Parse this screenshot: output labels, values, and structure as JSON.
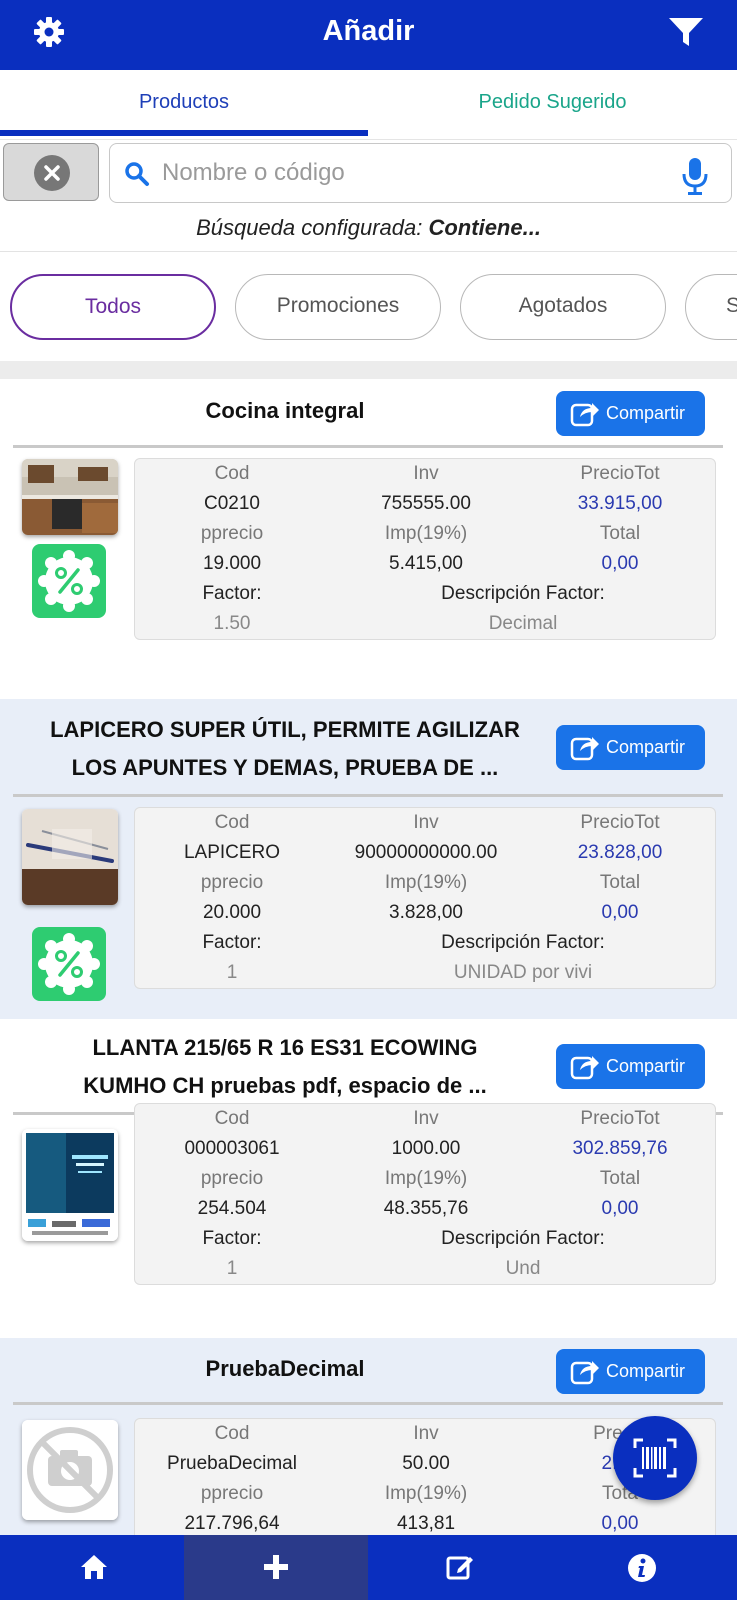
{
  "header": {
    "title": "Añadir",
    "settings_icon": "gear-icon",
    "filter_icon": "filter-icon"
  },
  "tabs": [
    {
      "label": "Productos",
      "active": true
    },
    {
      "label": "Pedido Sugerido",
      "active": false
    }
  ],
  "search": {
    "placeholder": "Nombre o código",
    "value": ""
  },
  "config": {
    "prefix": "Búsqueda configurada:",
    "mode": "Contiene..."
  },
  "chips": [
    {
      "label": "Todos",
      "active": true
    },
    {
      "label": "Promociones",
      "active": false
    },
    {
      "label": "Agotados",
      "active": false
    },
    {
      "label": "S",
      "active": false
    }
  ],
  "share_label": "Compartir",
  "labels": {
    "cod": "Cod",
    "inv": "Inv",
    "precio_tot": "PrecioTot",
    "pprecio": "pprecio",
    "imp": "Imp(19%)",
    "total": "Total",
    "factor": "Factor:",
    "descripcion_factor": "Descripción Factor:",
    "precio_tot_partial": "Precio",
    "total_partial": "Tota"
  },
  "products": [
    {
      "name": "Cocina integral",
      "cod": "C0210",
      "inv": "755555.00",
      "precio_tot": "33.915,00",
      "pprecio": "19.000",
      "imp": "5.415,00",
      "total": "0,00",
      "factor": "1.50",
      "descripcion_factor": "Decimal",
      "has_promo": true,
      "image": "kitchen-photo"
    },
    {
      "name_line1": "LAPICERO SUPER ÚTIL, PERMITE AGILIZAR",
      "name_line2": "LOS APUNTES Y DEMAS, PRUEBA DE ...",
      "cod": "LAPICERO",
      "inv": "90000000000.00",
      "precio_tot": "23.828,00",
      "pprecio": "20.000",
      "imp": "3.828,00",
      "total": "0,00",
      "factor": "1",
      "descripcion_factor": "UNIDAD por vivi",
      "has_promo": true,
      "image": "pen-photo"
    },
    {
      "name_line1": "LLANTA 215/65 R 16 ES31 ECOWING",
      "name_line2": "KUMHO CH pruebas pdf, espacio de ...",
      "cod": "000003061",
      "inv": "1000.00",
      "precio_tot": "302.859,76",
      "pprecio": "254.504",
      "imp": "48.355,76",
      "total": "0,00",
      "factor": "1",
      "descripcion_factor": "Und",
      "has_promo": false,
      "image": "poster-photo"
    },
    {
      "name": "PruebaDecimal",
      "cod": "PruebaDecimal",
      "inv": "50.00",
      "precio_tot_partial": "2.59",
      "pprecio": "217.796,64",
      "imp": "413,81",
      "total": "0,00",
      "has_promo": false,
      "image": "no-image"
    }
  ],
  "fab_icon": "barcode-scan-icon",
  "bottom_nav": [
    {
      "icon": "home-icon",
      "active": false
    },
    {
      "icon": "plus-icon",
      "active": true
    },
    {
      "icon": "edit-icon",
      "active": false
    },
    {
      "icon": "info-icon",
      "active": false
    }
  ],
  "colors": {
    "primary": "#0a2fbf",
    "tab_secondary": "#1aa58a",
    "chip_active": "#6a2da0",
    "share_button": "#1a73e8",
    "promo": "#2ecc71",
    "price_blue": "#2a3ab0",
    "card_alt_bg": "#e8eef8"
  }
}
